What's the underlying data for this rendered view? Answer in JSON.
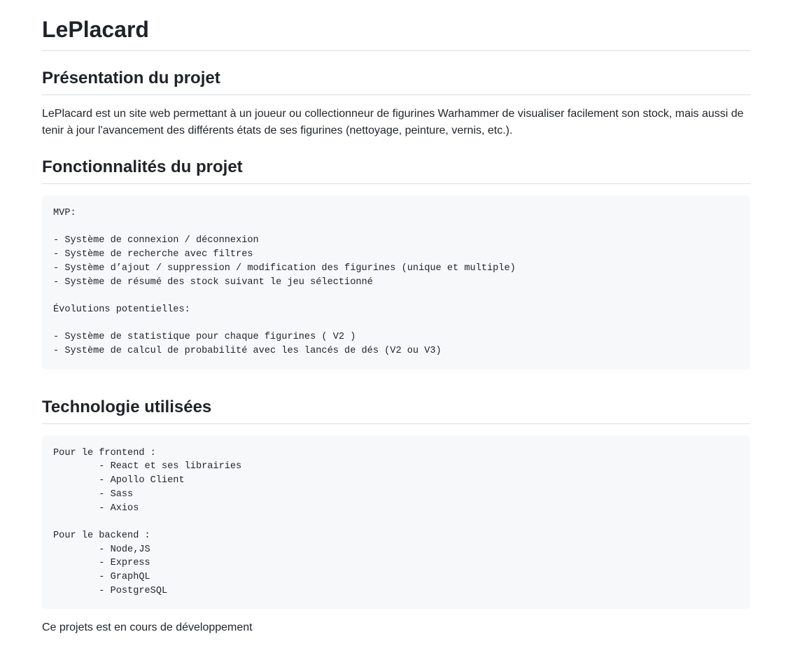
{
  "title": "LePlacard",
  "sections": {
    "presentation": {
      "heading": "Présentation du projet",
      "text": "LePlacard est un site web permettant à un joueur ou collectionneur de figurines Warhammer de visualiser facilement son stock, mais aussi de tenir à jour l'avancement des différents états de ses figurines (nettoyage, peinture, vernis, etc.)."
    },
    "features": {
      "heading": "Fonctionnalités du projet",
      "code": "MVP:\n\n- Système de connexion / déconnexion\n- Système de recherche avec filtres\n- Système d’ajout / suppression / modification des figurines (unique et multiple)\n- Système de résumé des stock suivant le jeu sélectionné\n\nÉvolutions potentielles:\n\n- Système de statistique pour chaque figurines ( V2 )\n- Système de calcul de probabilité avec les lancés de dés (V2 ou V3)"
    },
    "technology": {
      "heading": "Technologie utilisées",
      "code": "Pour le frontend :\n        - React et ses librairies\n        - Apollo Client\n        - Sass\n        - Axios\n\nPour le backend :\n        - Node,JS\n        - Express\n        - GraphQL\n        - PostgreSQL"
    }
  },
  "footer_note": "Ce projets est en cours de développement"
}
